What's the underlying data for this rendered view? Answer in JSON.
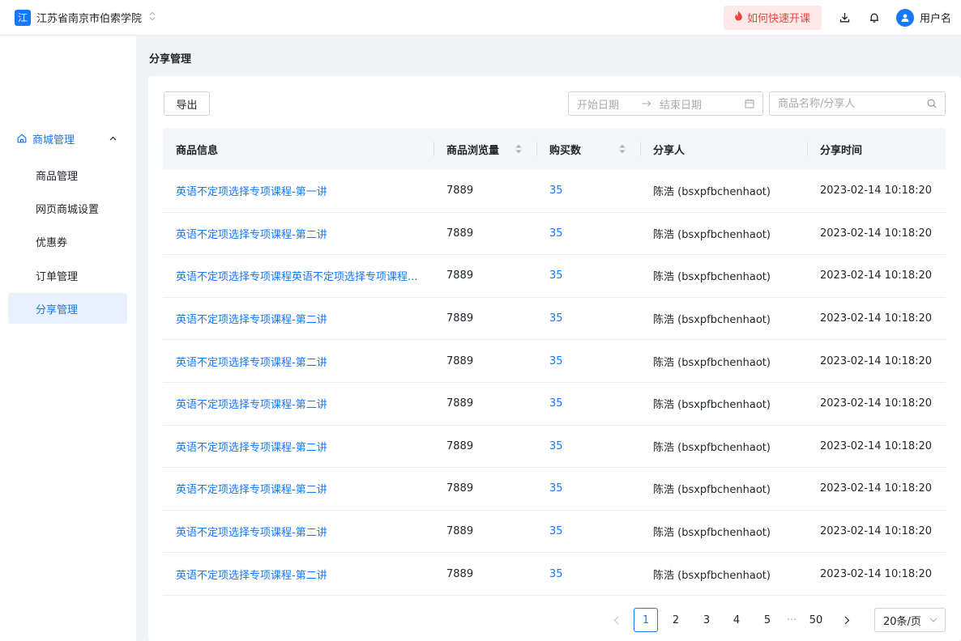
{
  "header": {
    "logo_char": "江",
    "org_name": "江苏省南京市伯索学院",
    "quick_start_label": "如何快速开课",
    "username": "用户名"
  },
  "sidebar": {
    "group_label": "商城管理",
    "items": [
      {
        "label": "商品管理"
      },
      {
        "label": "网页商城设置"
      },
      {
        "label": "优惠券"
      },
      {
        "label": "订单管理"
      },
      {
        "label": "分享管理",
        "active": true
      }
    ]
  },
  "page": {
    "breadcrumb": "分享管理"
  },
  "toolbar": {
    "export_label": "导出",
    "start_date_placeholder": "开始日期",
    "end_date_placeholder": "结束日期",
    "search_placeholder": "商品名称/分享人"
  },
  "table": {
    "columns": [
      "商品信息",
      "商品浏览量",
      "购买数",
      "分享人",
      "分享时间"
    ],
    "rows": [
      {
        "product": "英语不定项选择专项课程-第一讲",
        "views": "7889",
        "purchases": "35",
        "sharer": "陈浩 (bsxpfbchenhaot)",
        "time": "2023-02-14 10:18:20"
      },
      {
        "product": "英语不定项选择专项课程-第二讲",
        "views": "7889",
        "purchases": "35",
        "sharer": "陈浩 (bsxpfbchenhaot)",
        "time": "2023-02-14 10:18:20"
      },
      {
        "product": "英语不定项选择专项课程英语不定项选择专项课程...",
        "views": "7889",
        "purchases": "35",
        "sharer": "陈浩 (bsxpfbchenhaot)",
        "time": "2023-02-14 10:18:20"
      },
      {
        "product": "英语不定项选择专项课程-第二讲",
        "views": "7889",
        "purchases": "35",
        "sharer": "陈浩 (bsxpfbchenhaot)",
        "time": "2023-02-14 10:18:20"
      },
      {
        "product": "英语不定项选择专项课程-第二讲",
        "views": "7889",
        "purchases": "35",
        "sharer": "陈浩 (bsxpfbchenhaot)",
        "time": "2023-02-14 10:18:20"
      },
      {
        "product": "英语不定项选择专项课程-第二讲",
        "views": "7889",
        "purchases": "35",
        "sharer": "陈浩 (bsxpfbchenhaot)",
        "time": "2023-02-14 10:18:20"
      },
      {
        "product": "英语不定项选择专项课程-第二讲",
        "views": "7889",
        "purchases": "35",
        "sharer": "陈浩 (bsxpfbchenhaot)",
        "time": "2023-02-14 10:18:20"
      },
      {
        "product": "英语不定项选择专项课程-第二讲",
        "views": "7889",
        "purchases": "35",
        "sharer": "陈浩 (bsxpfbchenhaot)",
        "time": "2023-02-14 10:18:20"
      },
      {
        "product": "英语不定项选择专项课程-第二讲",
        "views": "7889",
        "purchases": "35",
        "sharer": "陈浩 (bsxpfbchenhaot)",
        "time": "2023-02-14 10:18:20"
      },
      {
        "product": "英语不定项选择专项课程-第二讲",
        "views": "7889",
        "purchases": "35",
        "sharer": "陈浩 (bsxpfbchenhaot)",
        "time": "2023-02-14 10:18:20"
      }
    ]
  },
  "pagination": {
    "pages": [
      "1",
      "2",
      "3",
      "4",
      "5"
    ],
    "current": "1",
    "ellipsis": "···",
    "last_page": "50",
    "page_size_label": "20条/页"
  },
  "colors": {
    "primary": "#1677ff",
    "quick_start_bg": "#fde9e7",
    "quick_start_text": "#e8473f",
    "active_menu_bg": "#e8f1fe"
  }
}
